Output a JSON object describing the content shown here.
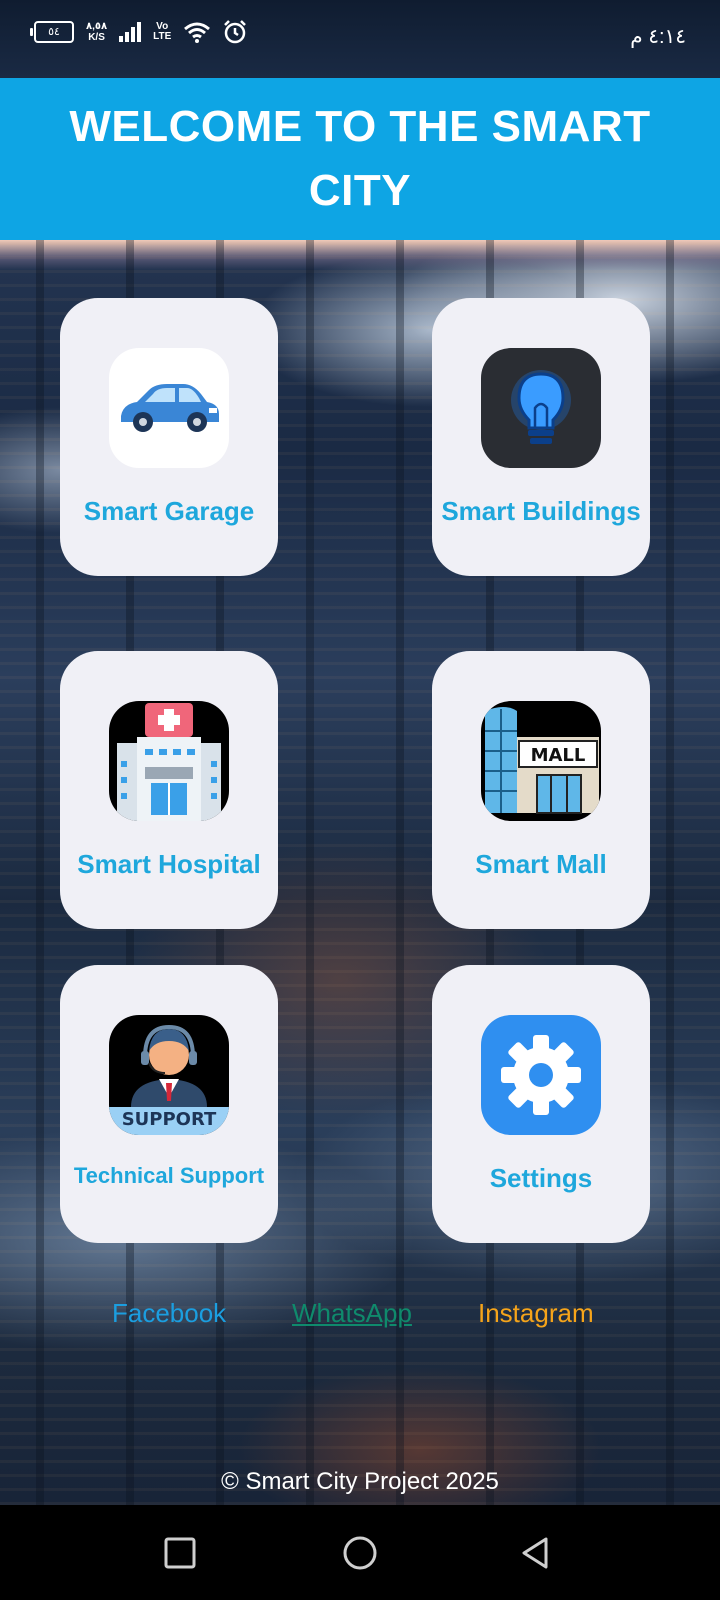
{
  "status_bar": {
    "battery": "٥٤",
    "net_speed": "٨,٥٨",
    "net_unit": "K/S",
    "volte_top": "Vo",
    "volte_bottom": "LTE",
    "time": "٤:١٤ م",
    "icons": [
      "battery-icon",
      "signal-icon",
      "volte-icon",
      "wifi-icon",
      "alarm-icon"
    ]
  },
  "header": {
    "title": "WELCOME TO THE SMART CITY"
  },
  "cards": [
    {
      "label": "Smart Garage",
      "icon": "car-icon"
    },
    {
      "label": "Smart Buildings",
      "icon": "lightbulb-icon"
    },
    {
      "label": "Smart Hospital",
      "icon": "hospital-icon"
    },
    {
      "label": "Smart Mall",
      "icon": "mall-icon",
      "icon_text": "MALL"
    },
    {
      "label": "Technical Support",
      "icon": "support-agent-icon",
      "icon_text": "SUPPORT"
    },
    {
      "label": "Settings",
      "icon": "gear-icon"
    }
  ],
  "social": {
    "facebook": "Facebook",
    "whatsapp": "WhatsApp",
    "instagram": "Instagram"
  },
  "colors": {
    "header": "#0ea5e4",
    "card": "#f0f0f6",
    "label": "#1ea7dc",
    "facebook": "#1b9ee0",
    "whatsapp": "#0f8a6c",
    "instagram": "#f5a41a"
  },
  "footer": {
    "text": "© Smart City Project 2025"
  },
  "nav": {
    "icons": [
      "recent-apps-icon",
      "home-icon",
      "back-icon"
    ]
  }
}
